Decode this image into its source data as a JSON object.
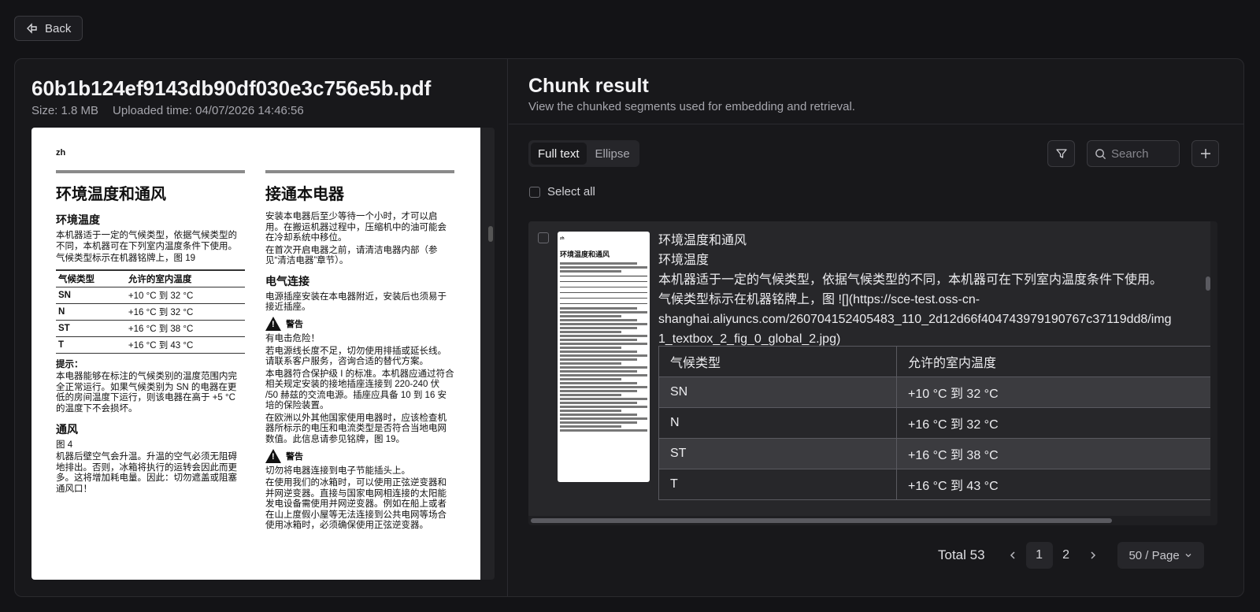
{
  "back": {
    "label": "Back"
  },
  "file": {
    "name": "60b1b124ef9143db90df030e3c756e5b.pdf",
    "size": "Size: 1.8 MB",
    "uploaded": "Uploaded time: 04/07/2026 14:46:56"
  },
  "pdf": {
    "lang": "zh",
    "left": {
      "heading": "环境温度和通风",
      "sub1": "环境温度",
      "p1": "本机器适于一定的气候类型，依据气候类型的不同，本机器可在下列室内温度条件下使用。",
      "p2": "气候类型标示在机器铭牌上，图 19",
      "table_headers": [
        "气候类型",
        "允许的室内温度"
      ],
      "table_rows": [
        [
          "SN",
          "+10 °C 到 32 °C"
        ],
        [
          "N",
          "+16 °C 到 32 °C"
        ],
        [
          "ST",
          "+16 °C 到 38 °C"
        ],
        [
          "T",
          "+16 °C 到 43 °C"
        ]
      ],
      "tip_label": "提示：",
      "tip": "本电器能够在标注的气候类别的温度范围内完全正常运行。如果气候类别为 SN 的电器在更低的房间温度下运行，则该电器在高于 +5 °C 的温度下不会损坏。",
      "sub2": "通风",
      "fig": "图 4",
      "p3": "机器后壁空气会升温。升温的空气必须无阻碍地排出。否则，冰箱将执行的运转会因此而更多。这将增加耗电量。因此：切勿遮盖或阻塞通风口！"
    },
    "right": {
      "heading": "接通本电器",
      "p1": "安装本电器后至少等待一个小时，才可以启用。在搬运机器过程中，压缩机中的油可能会在冷却系统中移位。",
      "p2": "在首次开启电器之前，请清洁电器内部（参见“清洁电器”章节）。",
      "sub1": "电气连接",
      "p3": "电源插座安装在本电器附近，安装后也须易于接近插座。",
      "warn1": "警告",
      "p4": "有电击危险！",
      "p5": "若电源线长度不足，切勿使用排插或延长线。请联系客户服务，咨询合适的替代方案。",
      "p6": "本电器符合保护级 I 的标准。本机器应通过符合相关规定安装的接地插座连接到 220-240 伏 /50 赫兹的交流电源。插座应具备 10 到 16 安培的保险装置。",
      "p7": "在欧洲以外其他国家使用电器时，应该检查机器所标示的电压和电流类型是否符合当地电网数值。此信息请参见铭牌，图 19。",
      "warn2": "警告",
      "p8": "切勿将电器连接到电子节能插头上。",
      "p9": "在使用我们的冰箱时，可以使用正弦逆变器和并网逆变器。直接与国家电网相连接的太阳能发电设备需使用并网逆变器。例如在船上或者在山上度假小屋等无法连接到公共电网等场合使用冰箱时，必须确保使用正弦逆变器。"
    }
  },
  "chunk": {
    "title": "Chunk result",
    "subtitle": "View the chunked segments used for embedding and retrieval.",
    "tabs": [
      "Full text",
      "Ellipse"
    ],
    "search_placeholder": "Search",
    "select_all": "Select all",
    "item": {
      "lines": [
        "环境温度和通风",
        "环境温度",
        "本机器适于一定的气候类型，依据气候类型的不同，本机器可在下列室内温度条件下使用。",
        "气候类型标示在机器铭牌上，图 ![](https://sce-test.oss-cn-",
        "shanghai.aliyuncs.com/260704152405483_110_2d12d66f404743979190767c37119dd8/img",
        "1_textbox_2_fig_0_global_2.jpg)"
      ],
      "table_headers": [
        "气候类型",
        "允许的室内温度"
      ],
      "table_rows": [
        [
          "SN",
          "+10 °C 到 32 °C"
        ],
        [
          "N",
          "+16 °C 到 32 °C"
        ],
        [
          "ST",
          "+16 °C 到 38 °C"
        ],
        [
          "T",
          "+16 °C 到 43 °C"
        ]
      ],
      "thumb_heading": "环境温度和通风"
    },
    "pagination": {
      "total": "Total 53",
      "pages": [
        "1",
        "2"
      ],
      "current": "1",
      "page_size": "50 / Page"
    }
  }
}
